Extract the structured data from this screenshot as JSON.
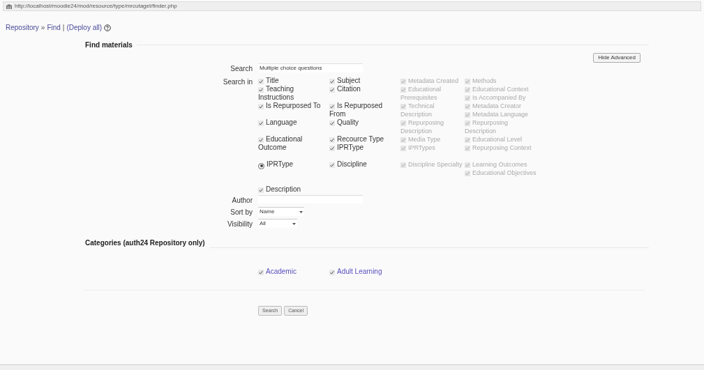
{
  "address_bar": {
    "url": "http://localhost/moodle24/mod/resource/type/mrcutaget/finder.php"
  },
  "breadcrumb": [
    {
      "text": "Repository",
      "kind": "link"
    },
    {
      "text": "»",
      "kind": "sep"
    },
    {
      "text": "Find",
      "kind": "link"
    },
    {
      "text": "|",
      "kind": "sep"
    },
    {
      "text": "(Deploy all)",
      "kind": "link"
    }
  ],
  "find_materials": {
    "legend": "Find materials",
    "hide_button": "Hide Advanced",
    "search": {
      "label": "Search",
      "value": "Multiple choice questions"
    },
    "search_in": {
      "label": "Search in",
      "rows": [
        [
          [
            {
              "label": "Title",
              "checked": true,
              "disabled": false,
              "kind": "checkbox"
            }
          ],
          [
            {
              "label": "Subject",
              "checked": true,
              "disabled": false,
              "kind": "checkbox"
            }
          ],
          [
            {
              "label": "Metadata Created",
              "checked": true,
              "disabled": true,
              "kind": "checkbox"
            }
          ],
          [
            {
              "label": "Methods",
              "checked": true,
              "disabled": true,
              "kind": "checkbox"
            }
          ]
        ],
        [
          [
            {
              "label": "Teaching Instructions",
              "checked": true,
              "disabled": false,
              "kind": "checkbox"
            }
          ],
          [
            {
              "label": "Citation",
              "checked": true,
              "disabled": false,
              "kind": "checkbox"
            }
          ],
          [
            {
              "label": "Educational Prerequisites",
              "checked": true,
              "disabled": true,
              "kind": "checkbox"
            }
          ],
          [
            {
              "label": "Educational Context",
              "checked": true,
              "disabled": true,
              "kind": "checkbox"
            },
            {
              "label": "Is Accompanied By",
              "checked": true,
              "disabled": true,
              "kind": "checkbox"
            }
          ]
        ],
        [
          [
            {
              "label": "Is Repurposed To",
              "checked": true,
              "disabled": false,
              "kind": "checkbox"
            }
          ],
          [
            {
              "label": "Is Repurposed From",
              "checked": true,
              "disabled": false,
              "kind": "checkbox"
            }
          ],
          [
            {
              "label": "Technical Description",
              "checked": true,
              "disabled": true,
              "kind": "checkbox"
            }
          ],
          [
            {
              "label": "Metadata Creator",
              "checked": true,
              "disabled": true,
              "kind": "checkbox"
            },
            {
              "label": "Metadata Language",
              "checked": true,
              "disabled": true,
              "kind": "checkbox"
            }
          ]
        ],
        [
          [
            {
              "label": "Language",
              "checked": true,
              "disabled": false,
              "kind": "checkbox"
            }
          ],
          [
            {
              "label": "Quality",
              "checked": true,
              "disabled": false,
              "kind": "checkbox"
            }
          ],
          [
            {
              "label": "Repurposing Description",
              "checked": true,
              "disabled": true,
              "kind": "checkbox"
            }
          ],
          [
            {
              "label": "Repurposing Description",
              "checked": true,
              "disabled": true,
              "kind": "checkbox"
            }
          ]
        ],
        [
          [
            {
              "label": "Educational Outcome",
              "checked": true,
              "disabled": false,
              "kind": "checkbox"
            }
          ],
          [
            {
              "label": "Recource Type",
              "checked": true,
              "disabled": false,
              "kind": "checkbox"
            },
            {
              "label": "IPRType",
              "checked": true,
              "disabled": false,
              "kind": "checkbox"
            }
          ],
          [
            {
              "label": "Media Type",
              "checked": true,
              "disabled": true,
              "kind": "checkbox"
            },
            {
              "label": "IPRTypes",
              "checked": true,
              "disabled": true,
              "kind": "checkbox"
            }
          ],
          [
            {
              "label": "Educational Level",
              "checked": true,
              "disabled": true,
              "kind": "checkbox"
            },
            {
              "label": "Repurposing Context",
              "checked": true,
              "disabled": true,
              "kind": "checkbox"
            }
          ]
        ],
        [
          [
            {
              "label": "IPRType",
              "checked": true,
              "disabled": false,
              "kind": "radio"
            }
          ],
          [
            {
              "label": "Discipline",
              "checked": true,
              "disabled": false,
              "kind": "checkbox"
            }
          ],
          [
            {
              "label": "Discipline Specialty",
              "checked": true,
              "disabled": true,
              "kind": "checkbox"
            }
          ],
          [
            {
              "label": "Learning Outcomes",
              "checked": true,
              "disabled": true,
              "kind": "checkbox"
            },
            {
              "label": "Educational Objectives",
              "checked": true,
              "disabled": true,
              "kind": "checkbox"
            }
          ]
        ],
        [
          [
            {
              "label": "Description",
              "checked": true,
              "disabled": false,
              "kind": "checkbox"
            }
          ],
          [],
          [],
          []
        ]
      ]
    },
    "author": {
      "label": "Author"
    },
    "sort_by": {
      "label": "Sort by",
      "value": "Name"
    },
    "visibility": {
      "label": "Visibility",
      "value": "All"
    }
  },
  "categories": {
    "legend": "Categories (auth24 Repository only)",
    "items": [
      {
        "label": "Academic",
        "checked": true
      },
      {
        "label": "Adult Learning",
        "checked": true
      }
    ]
  },
  "buttons": [
    "Search",
    "Cancel"
  ]
}
